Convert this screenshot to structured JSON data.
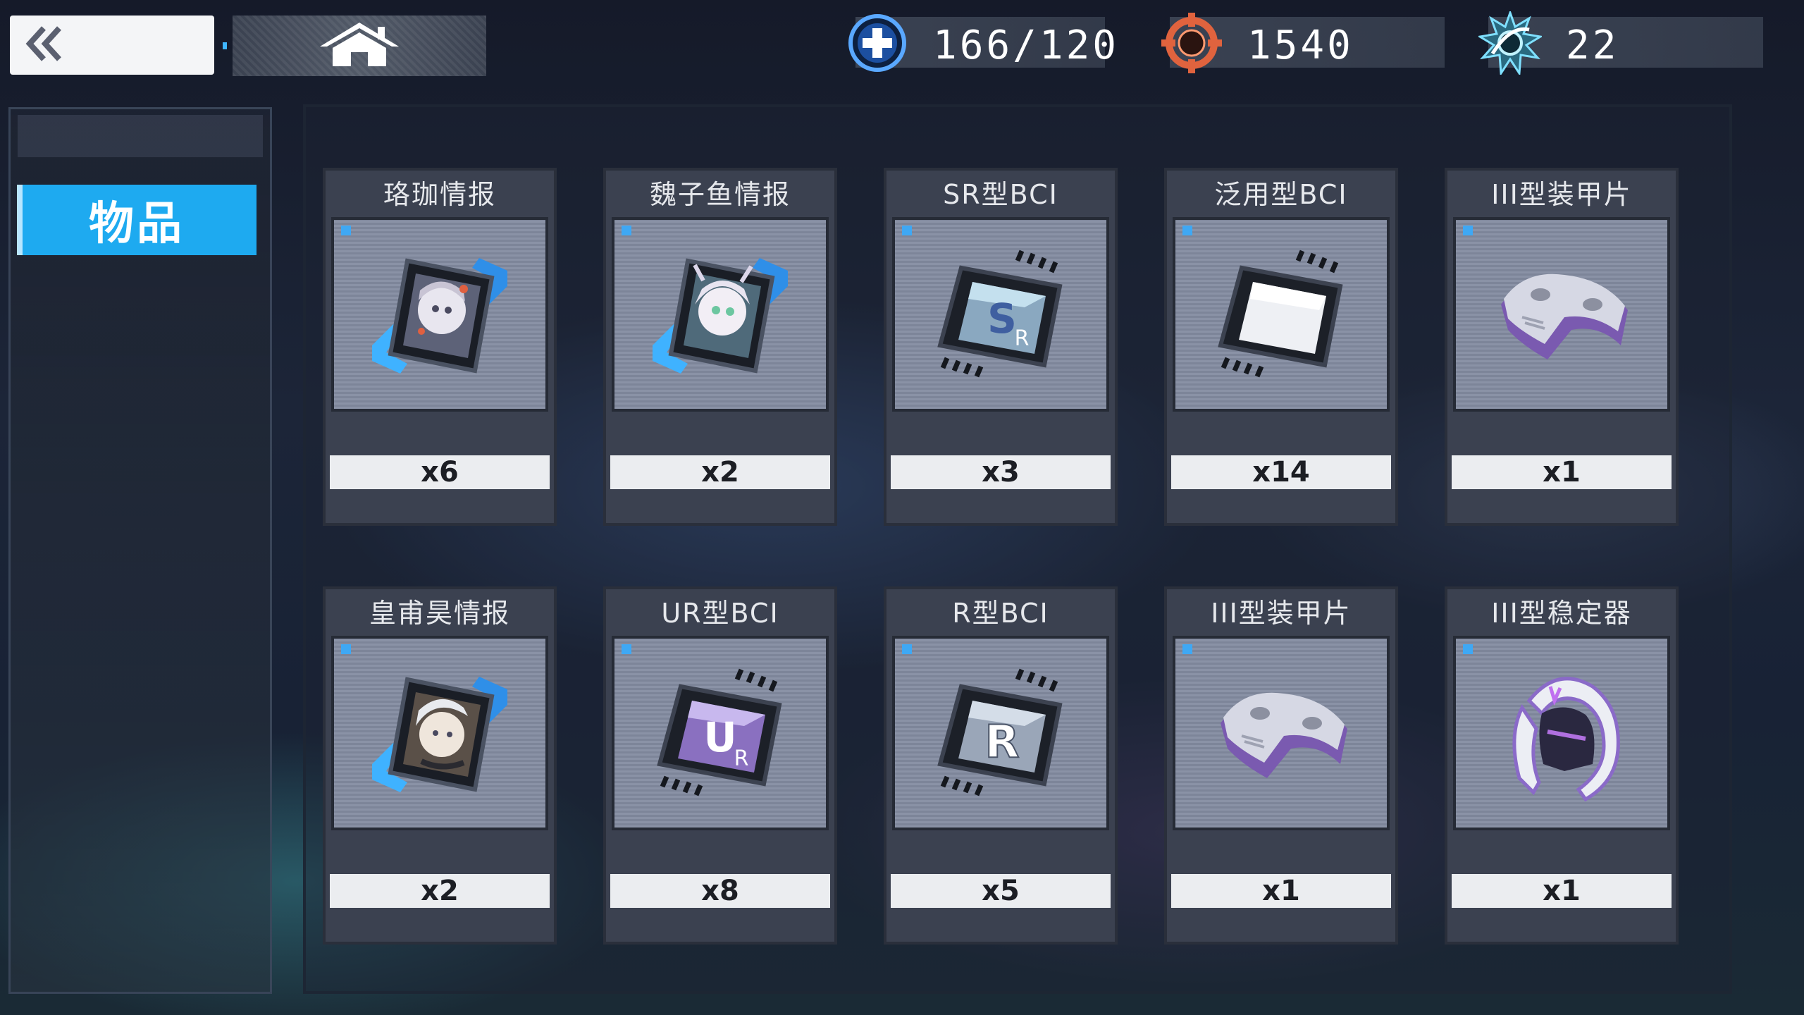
{
  "topbar": {
    "back_icon": "double-chevron-left-icon",
    "home_icon": "home-icon",
    "resources": [
      {
        "icon": "plus-circle-icon",
        "value": "166/120",
        "color": "#3f8fe0"
      },
      {
        "icon": "crosshair-icon",
        "value": "1540",
        "color": "#e06040"
      },
      {
        "icon": "gear-burst-icon",
        "value": "22",
        "color": "#40b8e0"
      }
    ]
  },
  "sidebar": {
    "tabs": [
      {
        "label": "物品",
        "active": true
      }
    ]
  },
  "items": [
    {
      "name": "珞珈情报",
      "count": "x6",
      "icon": "intel-card-icon"
    },
    {
      "name": "魏子鱼情报",
      "count": "x2",
      "icon": "intel-card-icon"
    },
    {
      "name": "SR型BCI",
      "count": "x3",
      "icon": "bci-chip-sr-icon"
    },
    {
      "name": "泛用型BCI",
      "count": "x14",
      "icon": "bci-chip-blank-icon"
    },
    {
      "name": "III型装甲片",
      "count": "x1",
      "icon": "armor-plate-icon"
    },
    {
      "name": "皇甫昊情报",
      "count": "x2",
      "icon": "intel-card-icon"
    },
    {
      "name": "UR型BCI",
      "count": "x8",
      "icon": "bci-chip-ur-icon"
    },
    {
      "name": "R型BCI",
      "count": "x5",
      "icon": "bci-chip-r-icon"
    },
    {
      "name": "III型装甲片",
      "count": "x1",
      "icon": "armor-plate-icon"
    },
    {
      "name": "III型稳定器",
      "count": "x1",
      "icon": "stabilizer-icon"
    }
  ],
  "colors": {
    "accent": "#1eaaf0",
    "card_bg": "#3b4150"
  }
}
